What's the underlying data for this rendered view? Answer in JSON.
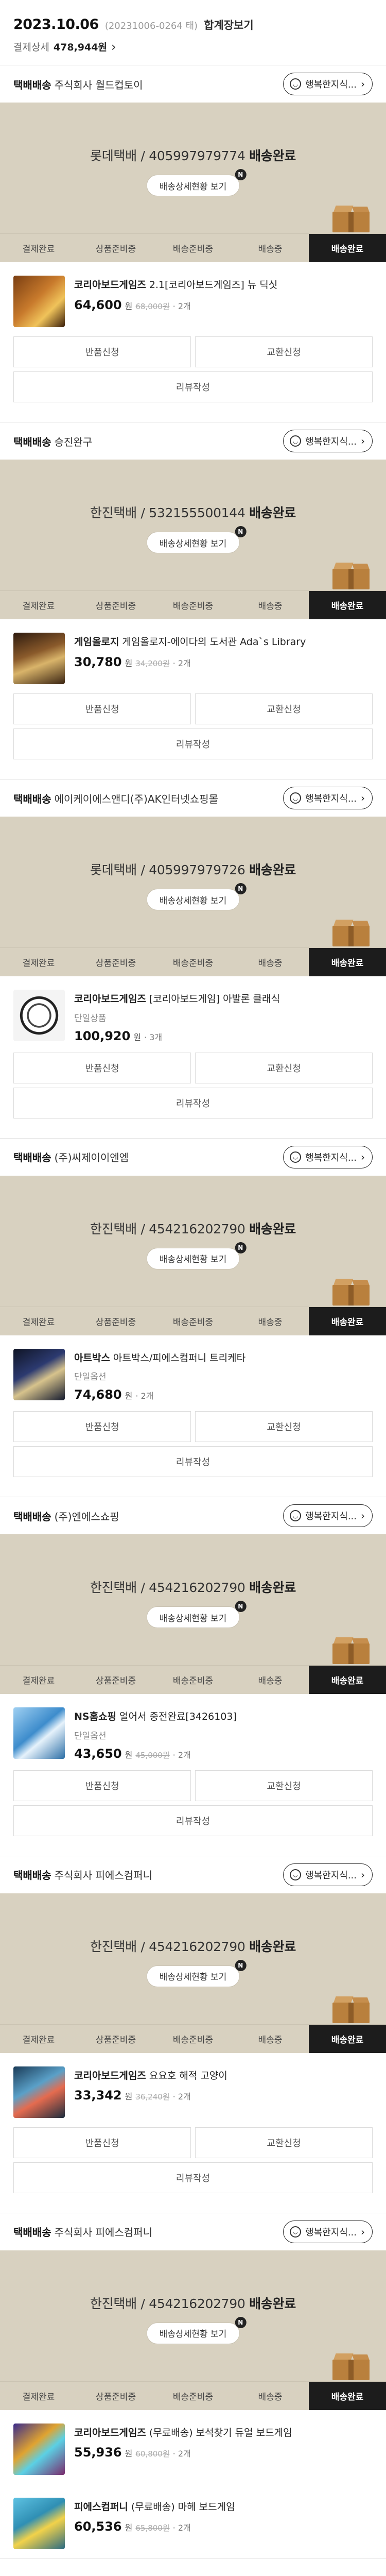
{
  "order": {
    "date": "2023.10.06",
    "number": "(20231006-0264 태)",
    "merged_label": "합계장보기",
    "payment_label": "결제상세",
    "payment_amount": "478,944원",
    "chevron": "›"
  },
  "labels": {
    "seller_prefix": "택배배송",
    "happy_button": "행복한지식...",
    "detail_button": "배송상세현황 보기",
    "detail_badge": "N",
    "won": "원",
    "return": "반품신청",
    "exchange": "교환신청",
    "review": "리뷰작성",
    "steps": [
      "결제완료",
      "상품준비중",
      "배송준비중",
      "배송중",
      "배송완료"
    ],
    "arrow": "›"
  },
  "groups": [
    {
      "seller": "주식회사 월드컵토이",
      "carrier": "롯데택배 / 405997979774",
      "status": "배송완료",
      "products": [
        {
          "name_brand": "코리아보드게임즈",
          "name": "2.1[코리아보드게임즈] 뉴 딕싯",
          "option": "",
          "price": "64,600",
          "orig": "68,000원",
          "qty": "· 2개",
          "thumb": "dixit-thumbnail"
        }
      ],
      "actions": true
    },
    {
      "seller": "승진완구",
      "carrier": "한진택배 / 532155500144",
      "status": "배송완료",
      "products": [
        {
          "name_brand": "게임올로지",
          "name": "게임올로지-에이다의 도서관 Ada`s Library",
          "option": "",
          "price": "30,780",
          "orig": "34,200원",
          "qty": "· 2개",
          "thumb": "ada-library-thumbnail"
        }
      ],
      "actions": true
    },
    {
      "seller": "에이케이에스앤디(주)AK인터넷쇼핑몰",
      "carrier": "롯데택배 / 405997979726",
      "status": "배송완료",
      "products": [
        {
          "name_brand": "코리아보드게임즈",
          "name": "[코리아보드게임] 아발론 클래식",
          "option": "단일상품",
          "price": "100,920",
          "orig": "",
          "qty": "· 3개",
          "thumb": "avalon-thumbnail"
        }
      ],
      "actions": true
    },
    {
      "seller": "(주)씨제이이엔엠",
      "carrier": "한진택배 / 454216202790",
      "status": "배송완료",
      "products": [
        {
          "name_brand": "아트박스",
          "name": "아트박스/피에스컴퍼니 트리케타",
          "option": "단일옵션",
          "price": "74,680",
          "orig": "",
          "qty": "· 2개",
          "thumb": "triqueta-thumbnail"
        }
      ],
      "actions": true
    },
    {
      "seller": "(주)엔에스쇼핑",
      "carrier": "한진택배 / 454216202790",
      "status": "배송완료",
      "products": [
        {
          "name_brand": "NS홈쇼핑",
          "name": "얼어서 중전완료[3426103]",
          "option": "단일옵션",
          "price": "43,650",
          "orig": "45,000원",
          "qty": "· 2개",
          "thumb": "ns-game-thumbnail"
        }
      ],
      "actions": true
    },
    {
      "seller": "주식회사 피에스컴퍼니",
      "carrier": "한진택배 / 454216202790",
      "status": "배송완료",
      "products": [
        {
          "name_brand": "코리아보드게임즈",
          "name": "요요호 해적 고양이",
          "option": "",
          "price": "33,342",
          "orig": "36,240원",
          "qty": "· 2개",
          "thumb": "pirate-cat-thumbnail"
        }
      ],
      "actions": true
    },
    {
      "seller": "주식회사 피에스컴퍼니",
      "carrier": "한진택배 / 454216202790",
      "status": "배송완료",
      "products": [
        {
          "name_brand": "코리아보드게임즈",
          "name": "(무료배송) 보석찾기 듀얼 보드게임",
          "option": "",
          "price": "55,936",
          "orig": "60,800원",
          "qty": "· 2개",
          "thumb": "gem-hunt-thumbnail"
        },
        {
          "name_brand": "피에스컴퍼니",
          "name": "(무료배송) 마헤 보드게임",
          "option": "",
          "price": "60,536",
          "orig": "65,800원",
          "qty": "· 2개",
          "thumb": "mahe-thumbnail"
        }
      ],
      "actions": false
    }
  ],
  "colors": {
    "track_bg": "#d8d1c0",
    "step_active_bg": "#1c1c1c",
    "box": "#b9803d"
  }
}
